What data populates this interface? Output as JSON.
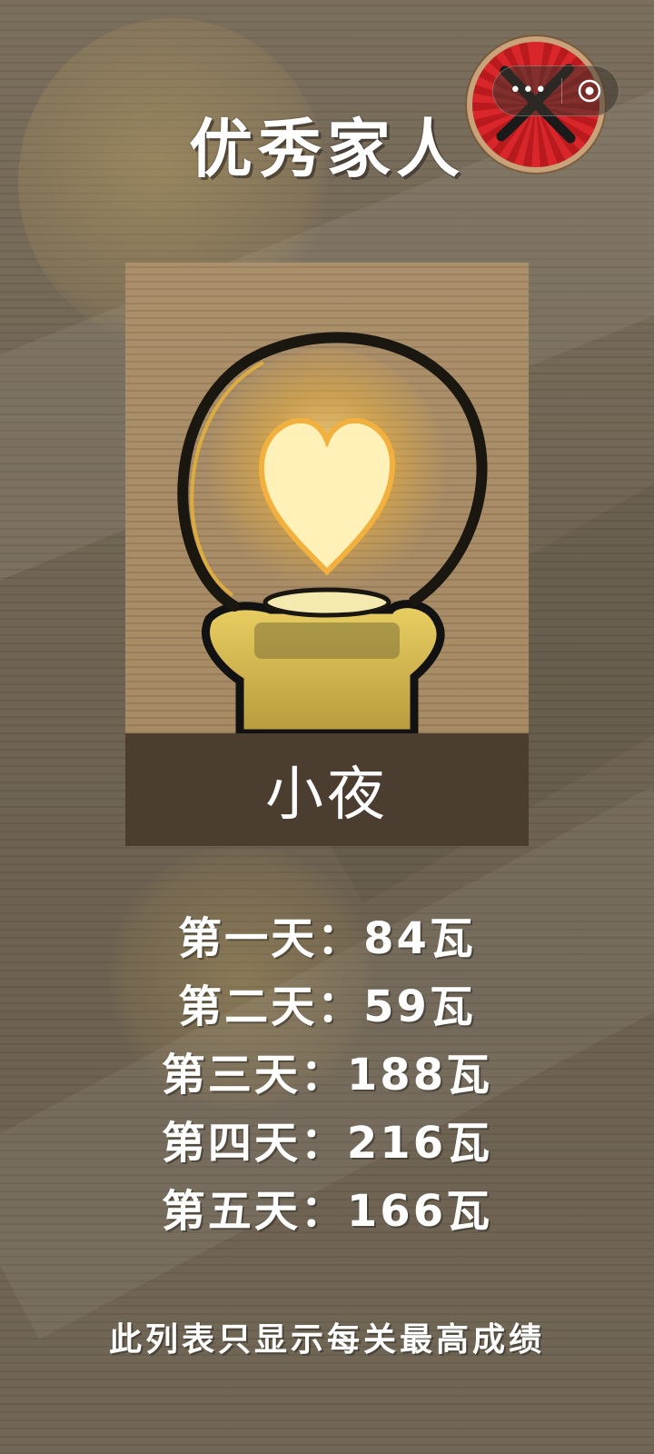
{
  "title": "优秀家人",
  "capsule": {
    "more_icon": "more-dots-icon",
    "close_icon": "target-close-icon"
  },
  "quit_badge": {
    "icon": "cross-out-icon"
  },
  "character": {
    "name": "小夜",
    "icon": "heart-bulb-icon"
  },
  "stats": [
    {
      "label": "第一天",
      "separator": "：",
      "value": "84瓦"
    },
    {
      "label": "第二天",
      "separator": "：",
      "value": "59瓦"
    },
    {
      "label": "第三天",
      "separator": "：",
      "value": "188瓦"
    },
    {
      "label": "第四天",
      "separator": "：",
      "value": "216瓦"
    },
    {
      "label": "第五天",
      "separator": "：",
      "value": "166瓦"
    }
  ],
  "note": "此列表只显示每关最高成绩",
  "colors": {
    "accent_red": "#d8262a",
    "name_bar": "#4b3d30",
    "bulb_glow": "#f3c24a"
  }
}
